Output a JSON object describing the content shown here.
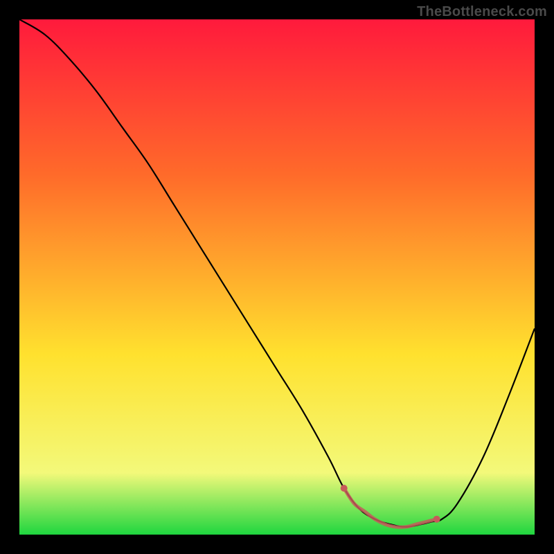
{
  "watermark": "TheBottleneck.com",
  "colors": {
    "background": "#000000",
    "gradient_top": "#ff1a3c",
    "gradient_upper_mid": "#ff6a2a",
    "gradient_mid": "#ffe12e",
    "gradient_lower": "#f3f97a",
    "gradient_bottom": "#1fd63f",
    "curve": "#000000",
    "marker_stroke": "#c65a5a",
    "marker_fill": "#c65a5a"
  },
  "chart_data": {
    "type": "line",
    "title": "",
    "xlabel": "",
    "ylabel": "",
    "xlim": [
      0,
      100
    ],
    "ylim": [
      0,
      100
    ],
    "grid": false,
    "series": [
      {
        "name": "bottleneck-curve",
        "x": [
          0,
          5,
          10,
          15,
          20,
          25,
          30,
          35,
          40,
          45,
          50,
          55,
          60,
          63,
          66,
          69,
          72,
          75,
          78,
          80,
          82,
          85,
          90,
          95,
          100
        ],
        "values": [
          100,
          97,
          92,
          86,
          79,
          72,
          64,
          56,
          48,
          40,
          32,
          24,
          15,
          9,
          5,
          3,
          2,
          1.5,
          2,
          2.5,
          3,
          6,
          15,
          27,
          40
        ]
      }
    ],
    "optimum_region": {
      "name": "optimum-markers",
      "x": [
        63,
        65,
        67,
        69,
        71,
        73,
        75,
        77,
        79,
        81
      ],
      "values": [
        9,
        6,
        4.5,
        3,
        2,
        1.5,
        1.5,
        2,
        2.5,
        3
      ]
    }
  }
}
